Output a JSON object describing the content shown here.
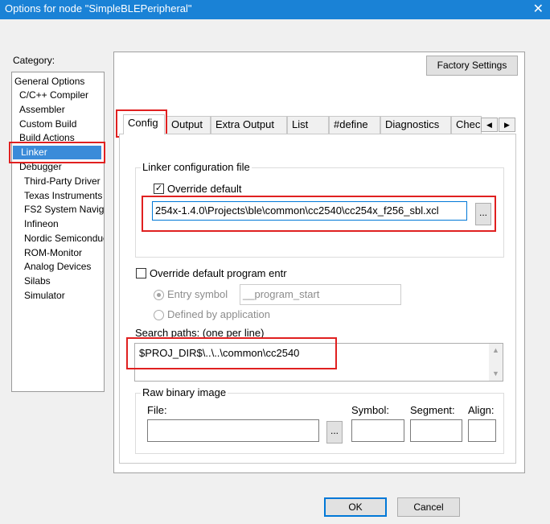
{
  "window": {
    "title": "Options for node \"SimpleBLEPeripheral\"",
    "close_glyph": "✕"
  },
  "category": {
    "label": "Category:",
    "items": [
      {
        "label": "General Options"
      },
      {
        "label": "C/C++ Compiler"
      },
      {
        "label": "Assembler"
      },
      {
        "label": "Custom Build"
      },
      {
        "label": "Build Actions"
      },
      {
        "label": "Linker",
        "selected": true
      },
      {
        "label": "Debugger"
      },
      {
        "label": "Third-Party Driver"
      },
      {
        "label": "Texas Instruments"
      },
      {
        "label": "FS2 System Navig"
      },
      {
        "label": "Infineon"
      },
      {
        "label": "Nordic Semiconduc"
      },
      {
        "label": "ROM-Monitor"
      },
      {
        "label": "Analog Devices"
      },
      {
        "label": "Silabs"
      },
      {
        "label": "Simulator"
      }
    ]
  },
  "factory_settings_label": "Factory Settings",
  "tabs": [
    {
      "label": "Config",
      "active": true
    },
    {
      "label": "Output"
    },
    {
      "label": "Extra Output"
    },
    {
      "label": "List"
    },
    {
      "label": "#define"
    },
    {
      "label": "Diagnostics"
    },
    {
      "label": "Chec"
    }
  ],
  "tab_scroll": {
    "left": "◀",
    "right": "▶"
  },
  "linker_config": {
    "group_label": "Linker configuration file",
    "override_label": "Override default",
    "override_checked": true,
    "check_glyph": "✓",
    "file_path": "254x-1.4.0\\Projects\\ble\\common\\cc2540\\cc254x_f256_sbl.xcl",
    "browse_label": "..."
  },
  "program_entry": {
    "override_label": "Override default program entr",
    "override_checked": false,
    "entry_symbol_label": "Entry symbol",
    "entry_symbol_value": "__program_start",
    "defined_by_app_label": "Defined by application"
  },
  "search_paths": {
    "label": "Search paths:  (one per line)",
    "value": "$PROJ_DIR$\\..\\..\\common\\cc2540",
    "scroll_up": "▲",
    "scroll_down": "▼"
  },
  "raw_binary": {
    "group_label": "Raw binary image",
    "file_label": "File:",
    "browse_label": "...",
    "symbol_label": "Symbol:",
    "segment_label": "Segment:",
    "align_label": "Align:"
  },
  "buttons": {
    "ok": "OK",
    "cancel": "Cancel"
  },
  "colors": {
    "titlebar": "#1a82d6",
    "selection": "#3a8bd9",
    "highlight_box": "#e02020",
    "focus_border": "#0078d7"
  }
}
